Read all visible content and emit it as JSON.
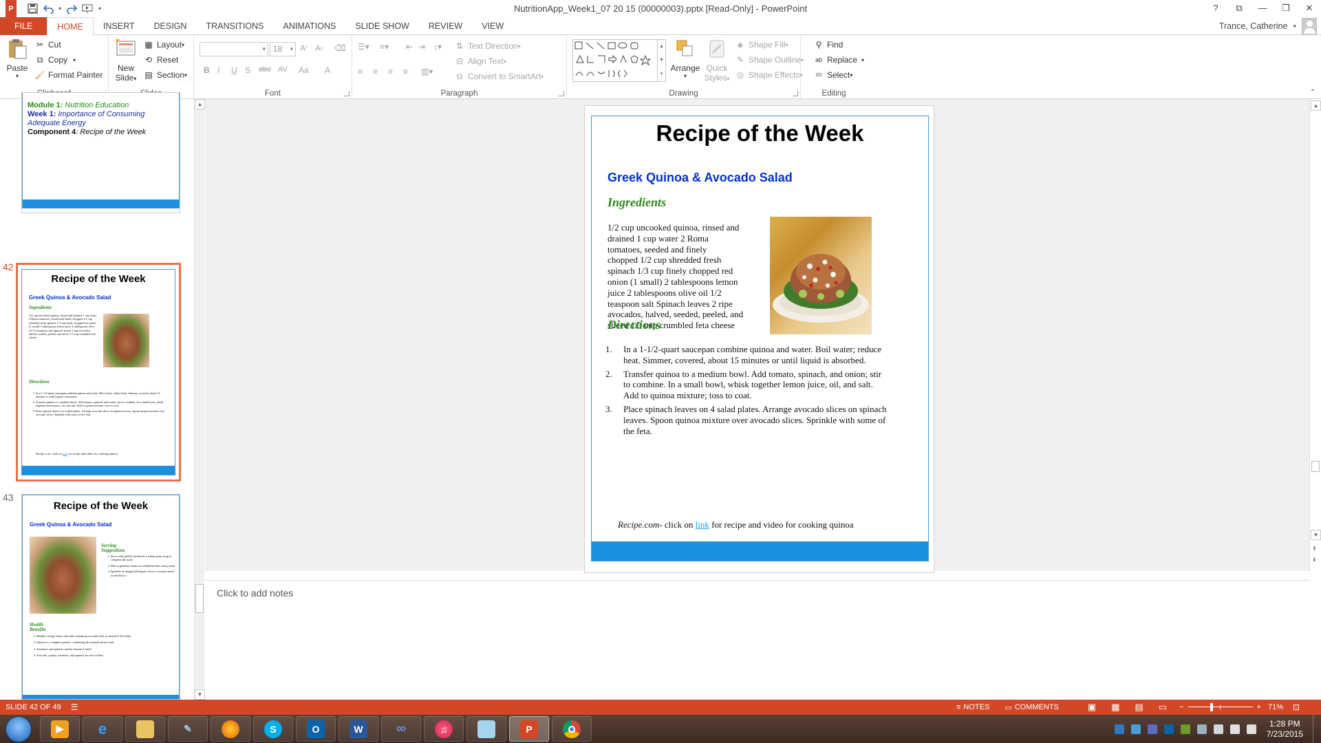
{
  "app": {
    "title": "NutritionApp_Week1_07 20 15 (00000003).pptx [Read-Only] - PowerPoint",
    "logo_letter": "P"
  },
  "window_controls": {
    "help": "?",
    "options": "⧉",
    "minimize": "—",
    "restore": "❐",
    "close": "✕"
  },
  "tabs": [
    "FILE",
    "HOME",
    "INSERT",
    "DESIGN",
    "TRANSITIONS",
    "ANIMATIONS",
    "SLIDE SHOW",
    "REVIEW",
    "VIEW"
  ],
  "active_tab": "HOME",
  "account": {
    "user": "Trance, Catherine"
  },
  "ribbon": {
    "clipboard": {
      "label": "Clipboard",
      "paste": "Paste",
      "cut": "Cut",
      "copy": "Copy",
      "format_painter": "Format Painter"
    },
    "slides": {
      "label": "Slides",
      "new_slide": "New",
      "new_slide_2": "Slide",
      "layout": "Layout",
      "reset": "Reset",
      "section": "Section"
    },
    "font": {
      "label": "Font",
      "font_name": "",
      "font_size": "18",
      "bold": "B",
      "italic": "I",
      "underline": "U",
      "shadow": "S",
      "strike": "abc",
      "spacing": "AV",
      "case": "Aa",
      "color": "A"
    },
    "paragraph": {
      "label": "Paragraph",
      "text_direction": "Text Direction",
      "align_text": "Align Text",
      "convert_smartart": "Convert to SmartArt"
    },
    "drawing": {
      "label": "Drawing",
      "arrange": "Arrange",
      "quick_styles": "Quick",
      "quick_styles_2": "Styles",
      "shape_fill": "Shape Fill",
      "shape_outline": "Shape Outline",
      "shape_effects": "Shape Effects"
    },
    "editing": {
      "label": "Editing",
      "find": "Find",
      "replace": "Replace",
      "select": "Select"
    }
  },
  "thumbnails": {
    "slide41": {
      "line1_bold": "Module 1:",
      "line1_rest": " Nutrition Education",
      "line2_bold": "Week 1:",
      "line2_rest": " Importance of Consuming Adequate Energy",
      "line3_bold": "Component 4",
      "line3_rest": ": Recipe of the Week"
    },
    "slide42": {
      "number": "42",
      "title": "Recipe of the Week",
      "subtitle": "Greek Quinoa & Avocado Salad",
      "ingredients_heading": "Ingredients",
      "ingredients": "1/2 cup uncooked quinoa, rinsed and drained 1 cup water 2 Roma tomatoes, seeded and finely chopped 1/2 cup shredded fresh spinach 1/3 cup finely chopped red onion (1 small) 2 tablespoons lemon juice 2 tablespoons olive oil 1/2 teaspoon salt Spinach leaves 2 ripe avocados, halved, seeded, peeled, and sliced 1/3 cup crumbled feta cheese",
      "directions_heading": "Directions",
      "directions": [
        "In a 1-1/2-quart saucepan combine quinoa and water. Boil water; reduce heat. Simmer, covered, about 15 minutes or until liquid is absorbed.",
        "Transfer quinoa to a medium bowl. Add tomato, spinach, and onion; stir to combine. In a small bowl, whisk together lemon juice, oil, and salt. Add to quinoa mixture; toss to coat.",
        "Place spinach leaves on a salad plates. Arrange avocado slices on spinach leaves. Spoon quinoa mixture over avocado slices. Sprinkle with some of the feta."
      ],
      "footer_italic": "Recipe.com",
      "footer_pre": "- click on ",
      "footer_link": "link",
      "footer_post": " for recipe and video for cooking quinoa"
    },
    "slide43": {
      "number": "43",
      "title": "Recipe of the Week",
      "subtitle": "Greek Quinoa & Avocado Salad",
      "serving_heading": "Serving Suggestions",
      "serving": [
        "Serve with grilled chicken & a whole grain wrap to complete the meal.",
        "Mix in garbanzo beans for additional fiber and protein",
        "Sprinkle in chopped Kalamata olives or sesame seeds to add flavor."
      ],
      "health_heading": "Health Benefits",
      "health": [
        "Healthy, energy-dense side dish containing avocado (rich in vitamin E & folate)",
        "Quinoa is a complete protein, containing all essential amino acids",
        "Tomatoes and spinach contain vitamin A and C",
        "Avocado, quinoa, tomatoes, and spinach are rich in fiber"
      ]
    }
  },
  "slide": {
    "title": "Recipe of the Week",
    "subtitle": "Greek Quinoa & Avocado Salad",
    "ingredients_heading": "Ingredients",
    "ingredients_lines": [
      "1/2 cup uncooked quinoa, rinsed and",
      "drained  1 cup water  2 Roma",
      "tomatoes, seeded and finely",
      "chopped  1/2 cup shredded fresh",
      "spinach  1/3 cup finely chopped red",
      "onion (1 small)  2 tablespoons lemon",
      "juice  2 tablespoons olive oil  1/2",
      "teaspoon salt  Spinach leaves  2 ripe",
      "avocados, halved, seeded, peeled, and",
      "sliced  1/3 cup crumbled feta cheese"
    ],
    "directions_heading": "Directions",
    "directions": [
      {
        "num": "1.",
        "lines": [
          "In a 1-1/2-quart saucepan combine quinoa and water. Boil water; reduce",
          "heat. Simmer, covered, about 15 minutes or until liquid is absorbed."
        ]
      },
      {
        "num": "2.",
        "lines": [
          "Transfer quinoa to a medium bowl.  Add tomato, spinach, and onion; stir",
          "to combine.  In a small bowl, whisk together lemon juice, oil, and salt.",
          "Add to quinoa mixture; toss to coat."
        ]
      },
      {
        "num": "3.",
        "lines": [
          "Place spinach leaves on 4 salad plates.  Arrange avocado slices on spinach",
          "leaves.  Spoon quinoa mixture over avocado slices.  Sprinkle with some of",
          "the feta."
        ]
      }
    ],
    "footer_italic": "Recipe.com",
    "footer_pre": "- click on ",
    "footer_link": "link",
    "footer_post": " for recipe and video for cooking quinoa"
  },
  "notes": {
    "placeholder": "Click to add notes"
  },
  "status": {
    "slide_counter": "SLIDE 42 OF 49",
    "notes": "NOTES",
    "comments": "COMMENTS",
    "zoom": "71%",
    "zoom_fraction": 0.36
  },
  "taskbar": {
    "apps": [
      "media-player",
      "internet-explorer",
      "file-explorer",
      "tools",
      "firefox",
      "skype",
      "outlook",
      "word",
      "lync",
      "itunes",
      "notepad",
      "powerpoint",
      "chrome"
    ],
    "active_app": "powerpoint",
    "time": "1:28 PM",
    "date": "7/23/2015"
  },
  "colors": {
    "accent": "#d24726",
    "slide_blue": "#1b8fe0",
    "subtitle_blue": "#0033cc",
    "heading_green": "#2a8a1c",
    "link_blue": "#1fa0e6"
  }
}
